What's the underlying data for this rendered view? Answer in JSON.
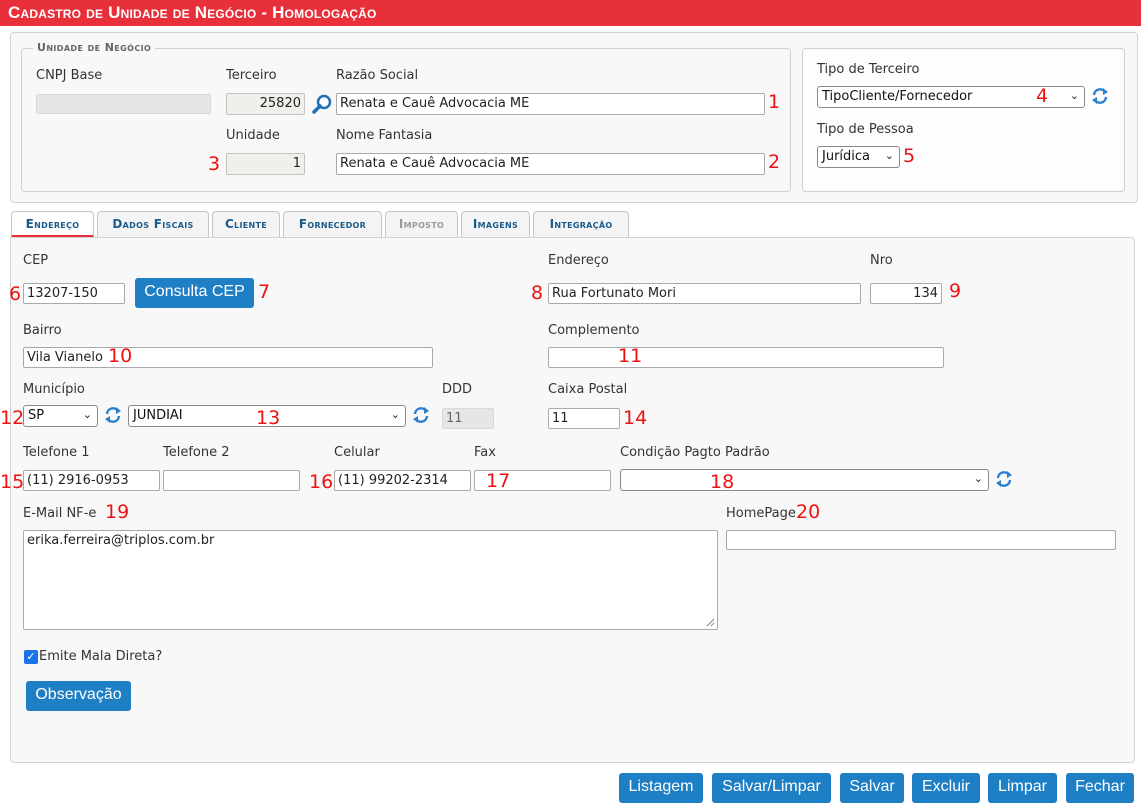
{
  "header": {
    "title": "Cadastro de Unidade de Negócio  - Homologação"
  },
  "unidade": {
    "legend": "Unidade de Negócio",
    "cnpj_label": "CNPJ Base",
    "cnpj_value": "",
    "terceiro_label": "Terceiro",
    "terceiro_value": "25820",
    "razao_label": "Razão Social",
    "razao_value": "Renata e Cauê Advocacia ME",
    "unidade_label": "Unidade",
    "unidade_value": "1",
    "fantasia_label": "Nome Fantasia",
    "fantasia_value": "Renata e Cauê Advocacia ME"
  },
  "tipo": {
    "terceiro_label": "Tipo de Terceiro",
    "terceiro_value": "TipoCliente/Fornecedor",
    "pessoa_label": "Tipo de Pessoa",
    "pessoa_value": "Jurídica"
  },
  "tabs": [
    {
      "label": "Endereço",
      "state": "active"
    },
    {
      "label": "Dados Fiscais",
      "state": "normal"
    },
    {
      "label": "Cliente",
      "state": "normal"
    },
    {
      "label": "Fornecedor",
      "state": "normal"
    },
    {
      "label": "Imposto",
      "state": "disabled"
    },
    {
      "label": "Imagens",
      "state": "normal"
    },
    {
      "label": "Integração",
      "state": "normal"
    }
  ],
  "endereco": {
    "cep_label": "CEP",
    "cep_value": "13207-150",
    "consulta_label": "Consulta CEP",
    "endereco_label": "Endereço",
    "endereco_value": "Rua Fortunato Mori",
    "nro_label": "Nro",
    "nro_value": "134",
    "bairro_label": "Bairro",
    "bairro_value": "Vila Vianelo",
    "complemento_label": "Complemento",
    "complemento_value": "",
    "municipio_label": "Município",
    "uf_value": "SP",
    "cidade_value": "JUNDIAI",
    "ddd_label": "DDD",
    "ddd_value": "11",
    "caixa_label": "Caixa Postal",
    "caixa_value": "11",
    "tel1_label": "Telefone 1",
    "tel1_value": "(11) 2916-0953",
    "tel2_label": "Telefone 2",
    "tel2_value": "",
    "cel_label": "Celular",
    "cel_value": "(11) 99202-2314",
    "fax_label": "Fax",
    "fax_value": "",
    "cond_label": "Condição Pagto Padrão",
    "cond_value": "",
    "email_label": "E-Mail NF-e",
    "email_value": "erika.ferreira@triplos.com.br",
    "homepage_label": "HomePage",
    "homepage_value": "",
    "mala_label": "Emite Mala Direta?",
    "mala_checked": true,
    "obs_label": "Observação"
  },
  "annotations": [
    "1",
    "2",
    "3",
    "4",
    "5",
    "6",
    "7",
    "8",
    "9",
    "10",
    "11",
    "12",
    "13",
    "14",
    "15",
    "16",
    "17",
    "18",
    "19",
    "20"
  ],
  "footer": {
    "listagem": "Listagem",
    "salvar_limpar": "Salvar/Limpar",
    "salvar": "Salvar",
    "excluir": "Excluir",
    "limpar": "Limpar",
    "fechar": "Fechar"
  },
  "colors": {
    "header_bg": "#e8303a",
    "button_bg": "#1f7fc4",
    "annotation": "#e11111"
  }
}
